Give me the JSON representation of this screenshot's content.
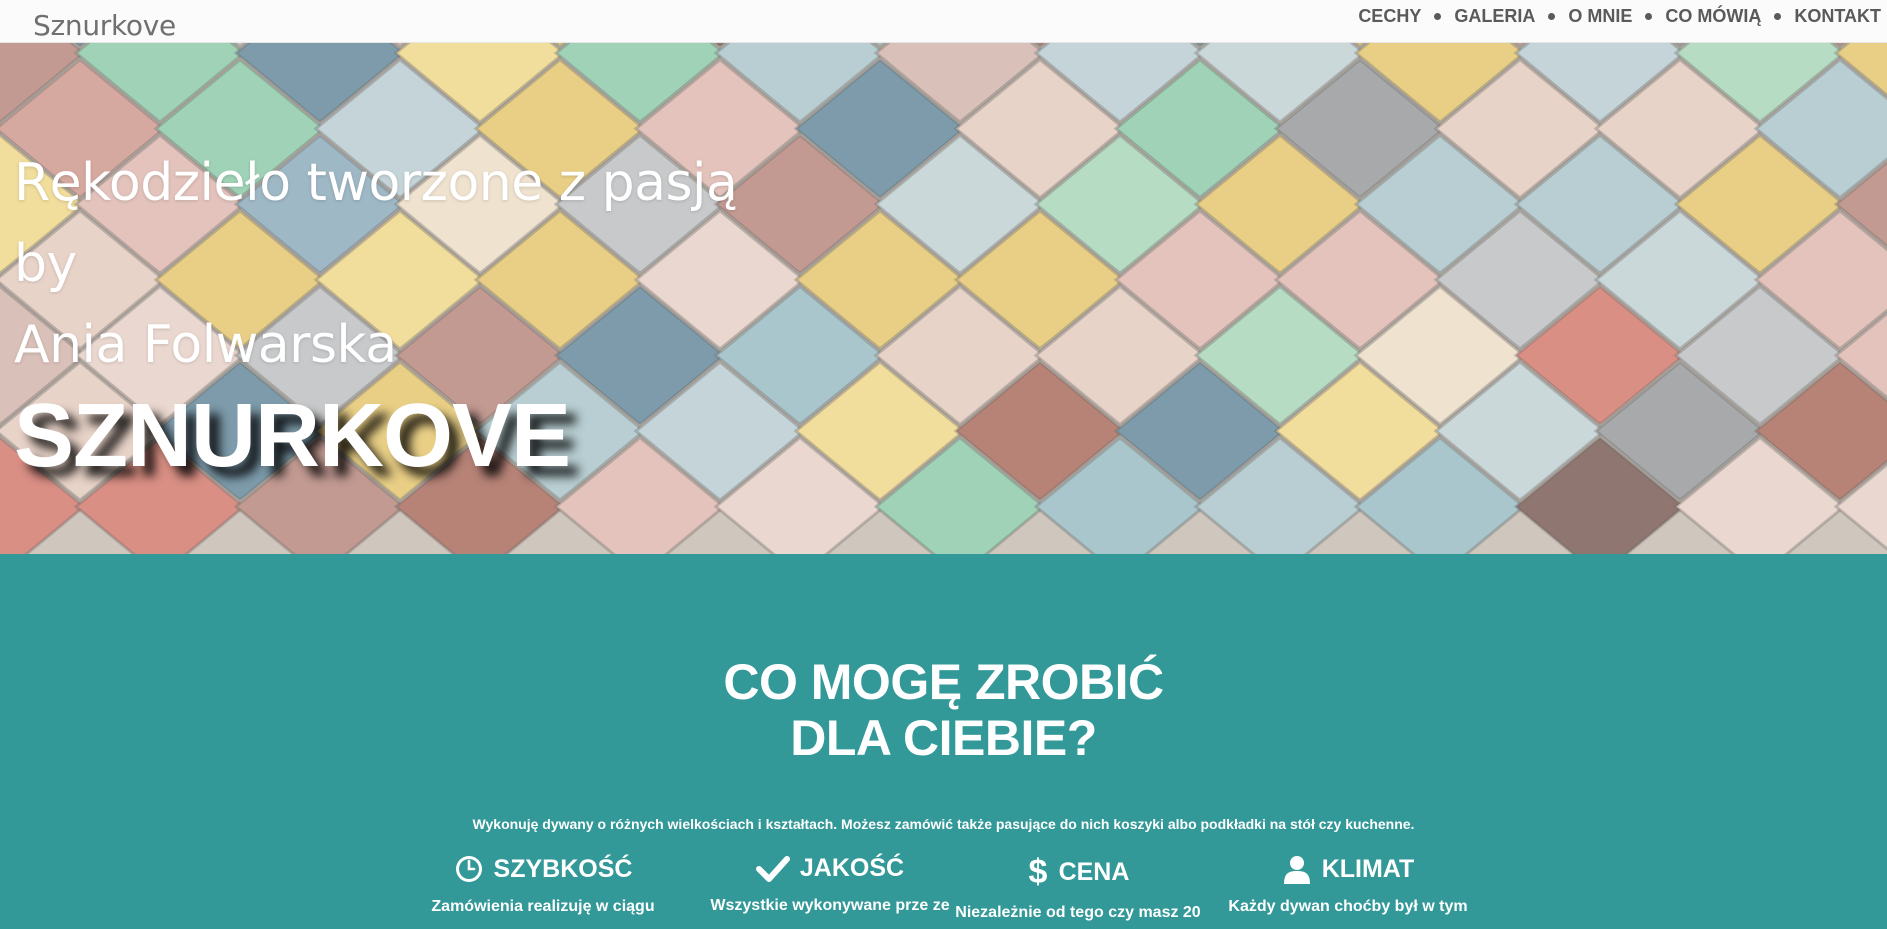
{
  "nav": {
    "brand": "Sznurkove",
    "items": [
      "CECHY",
      "GALERIA",
      "O MNIE",
      "CO MÓWIĄ",
      "KONTAKT"
    ]
  },
  "hero": {
    "lines": [
      "Rękodzieło tworzone z pasją",
      "by",
      "Ania Folwarska"
    ],
    "title": "SZNURKOVE"
  },
  "features": {
    "title_line1": "CO MOGĘ ZROBIĆ",
    "title_line2": "DLA CIEBIE?",
    "lead": "Wykonuję dywany o różnych wielkościach i kształtach. Możesz zamówić także pasujące do nich koszyki albo podkładki na stół czy kuchenne.",
    "items": [
      {
        "icon": "clock-icon",
        "title": "SZYBKOŚĆ",
        "text": "Zamówienia realizuję w ciągu"
      },
      {
        "icon": "check-icon",
        "title": "JAKOŚĆ",
        "text": "Wszystkie wykonywane prze ze"
      },
      {
        "icon": "dollar-icon",
        "title": "CENA",
        "text": "Niezależnie od tego czy masz 20"
      },
      {
        "icon": "user-icon",
        "title": "KLIMAT",
        "text": "Każdy dywan choćby był w tym"
      }
    ]
  },
  "colors": {
    "teal": "#329898",
    "nav_bg": "#fbfbfb",
    "nav_text": "#5a5a5a"
  }
}
